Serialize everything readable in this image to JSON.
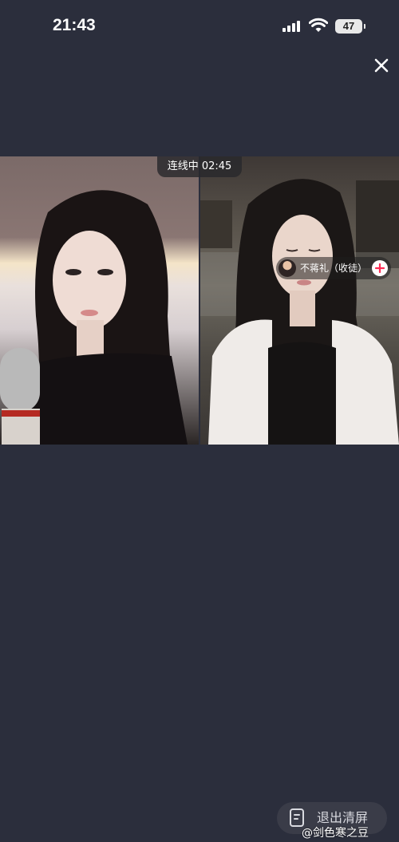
{
  "status_bar": {
    "time": "21:43",
    "battery": "47"
  },
  "live": {
    "timer_label": "连线中 02:45"
  },
  "guest": {
    "name": "不蒋礼（收徒）"
  },
  "exit_clean": {
    "label": "退出清屏"
  },
  "watermark": {
    "text": "@剑色寒之豆"
  },
  "icons": {
    "close": "close-icon",
    "signal": "cellular-signal-icon",
    "wifi": "wifi-icon",
    "follow": "plus-icon",
    "exit": "exit-clean-icon"
  },
  "colors": {
    "background": "#2b2e3c",
    "follow_accent": "#fe2c55"
  }
}
